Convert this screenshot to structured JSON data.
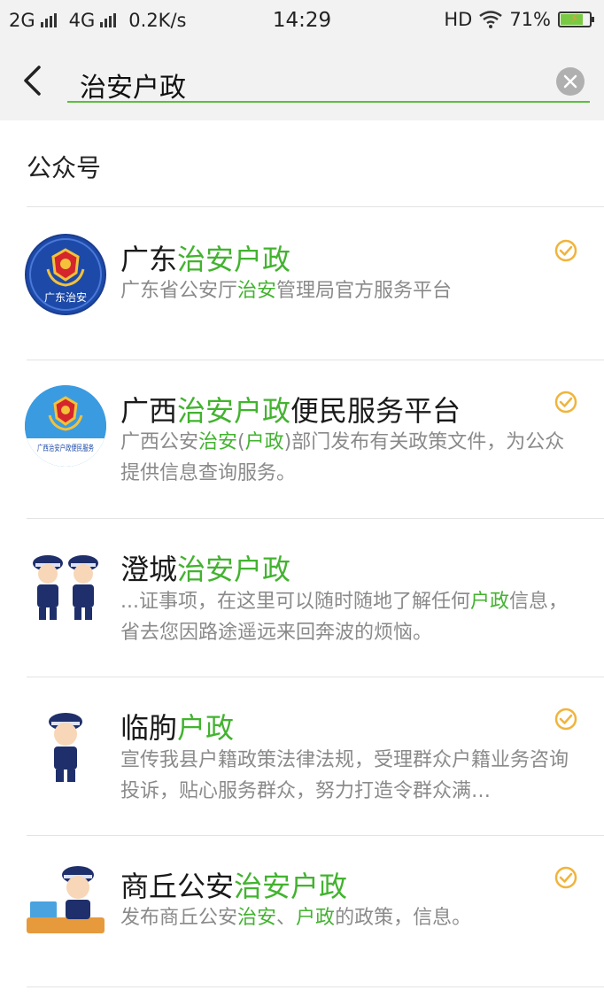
{
  "status": {
    "net1": "2G",
    "net2": "4G",
    "speed": "0.2K/s",
    "time": "14:29",
    "hd": "HD",
    "battery": "71%"
  },
  "search": {
    "query": "治安户政"
  },
  "section": {
    "title": "公众号"
  },
  "results": [
    {
      "title_parts": [
        "广东",
        "治安户政"
      ],
      "desc_parts": [
        "广东省公安厅",
        "治安",
        "管理局官方服务平台"
      ],
      "avatar_text": "广东治安",
      "verified": true
    },
    {
      "title_parts": [
        "广西",
        "治安户政",
        "便民服务平台"
      ],
      "desc_parts": [
        "广西公安",
        "治安",
        "(",
        "户政",
        ")部门发布有关政策文件，为公众提供信息查询服务。"
      ],
      "avatar_text": "广西治安户政便民服务",
      "verified": true
    },
    {
      "title_parts": [
        "澄城",
        "治安户政"
      ],
      "desc_parts": [
        "...证事项，在这里可以随时随地了解任何",
        "户政",
        "信息，省去您因路途遥远来回奔波的烦恼。"
      ],
      "verified": false
    },
    {
      "title_parts": [
        "临朐",
        "户政"
      ],
      "desc_parts": [
        "宣传我县户籍政策法律法规，受理群众户籍业务咨询投诉，贴心服务群众，努力打造令群众满…"
      ],
      "verified": true
    },
    {
      "title_parts": [
        "商丘公安",
        "治安户政"
      ],
      "desc_parts": [
        "发布商丘公安",
        "治安",
        "、",
        "户政",
        "的政策，信息。"
      ],
      "verified": true
    }
  ],
  "colors": {
    "highlight": "#42b32f",
    "verified": "#f0b43c",
    "accent_underline": "#5bbf3c"
  }
}
